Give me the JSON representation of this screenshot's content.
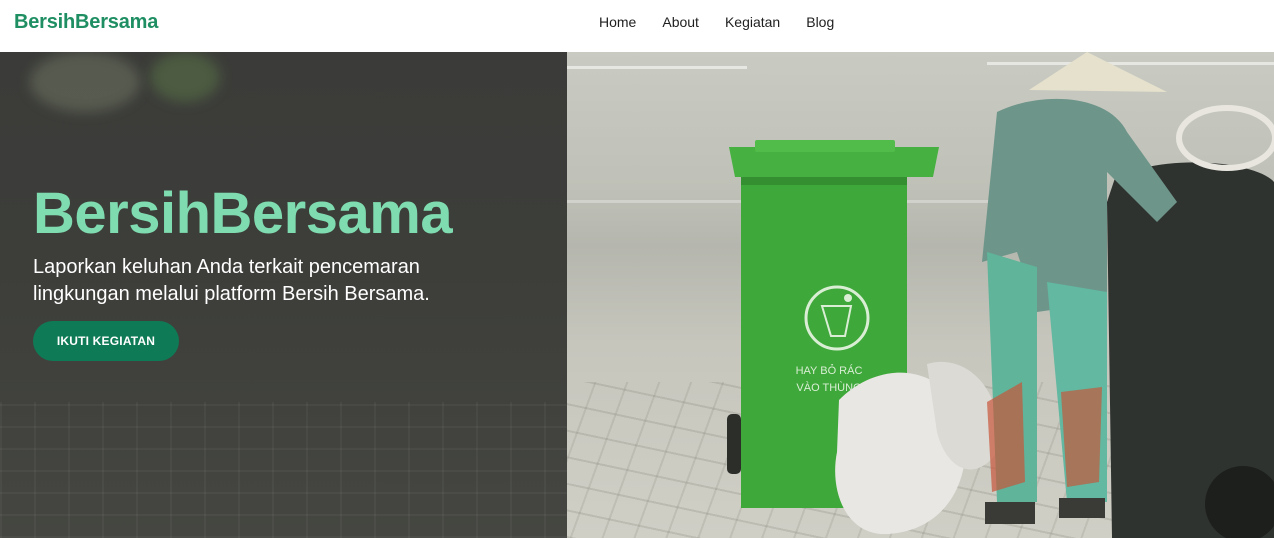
{
  "brand": "BersihBersama",
  "nav": {
    "items": [
      {
        "label": "Home"
      },
      {
        "label": "About"
      },
      {
        "label": "Kegiatan"
      },
      {
        "label": "Blog"
      }
    ]
  },
  "hero": {
    "title": "BersihBersama",
    "description": "Laporkan keluhan Anda terkait pencemaran lingkungan melalui platform Bersih Bersama.",
    "cta_label": "IKUTI KEGIATAN",
    "bin_text_line1": "HAY BỎ RÁC",
    "bin_text_line2": "VÀO THÙNG"
  },
  "colors": {
    "brand": "#1f8f63",
    "hero_title": "#7fdcb0",
    "cta_bg": "#0f7a56",
    "bin_green": "#3ea83a"
  }
}
